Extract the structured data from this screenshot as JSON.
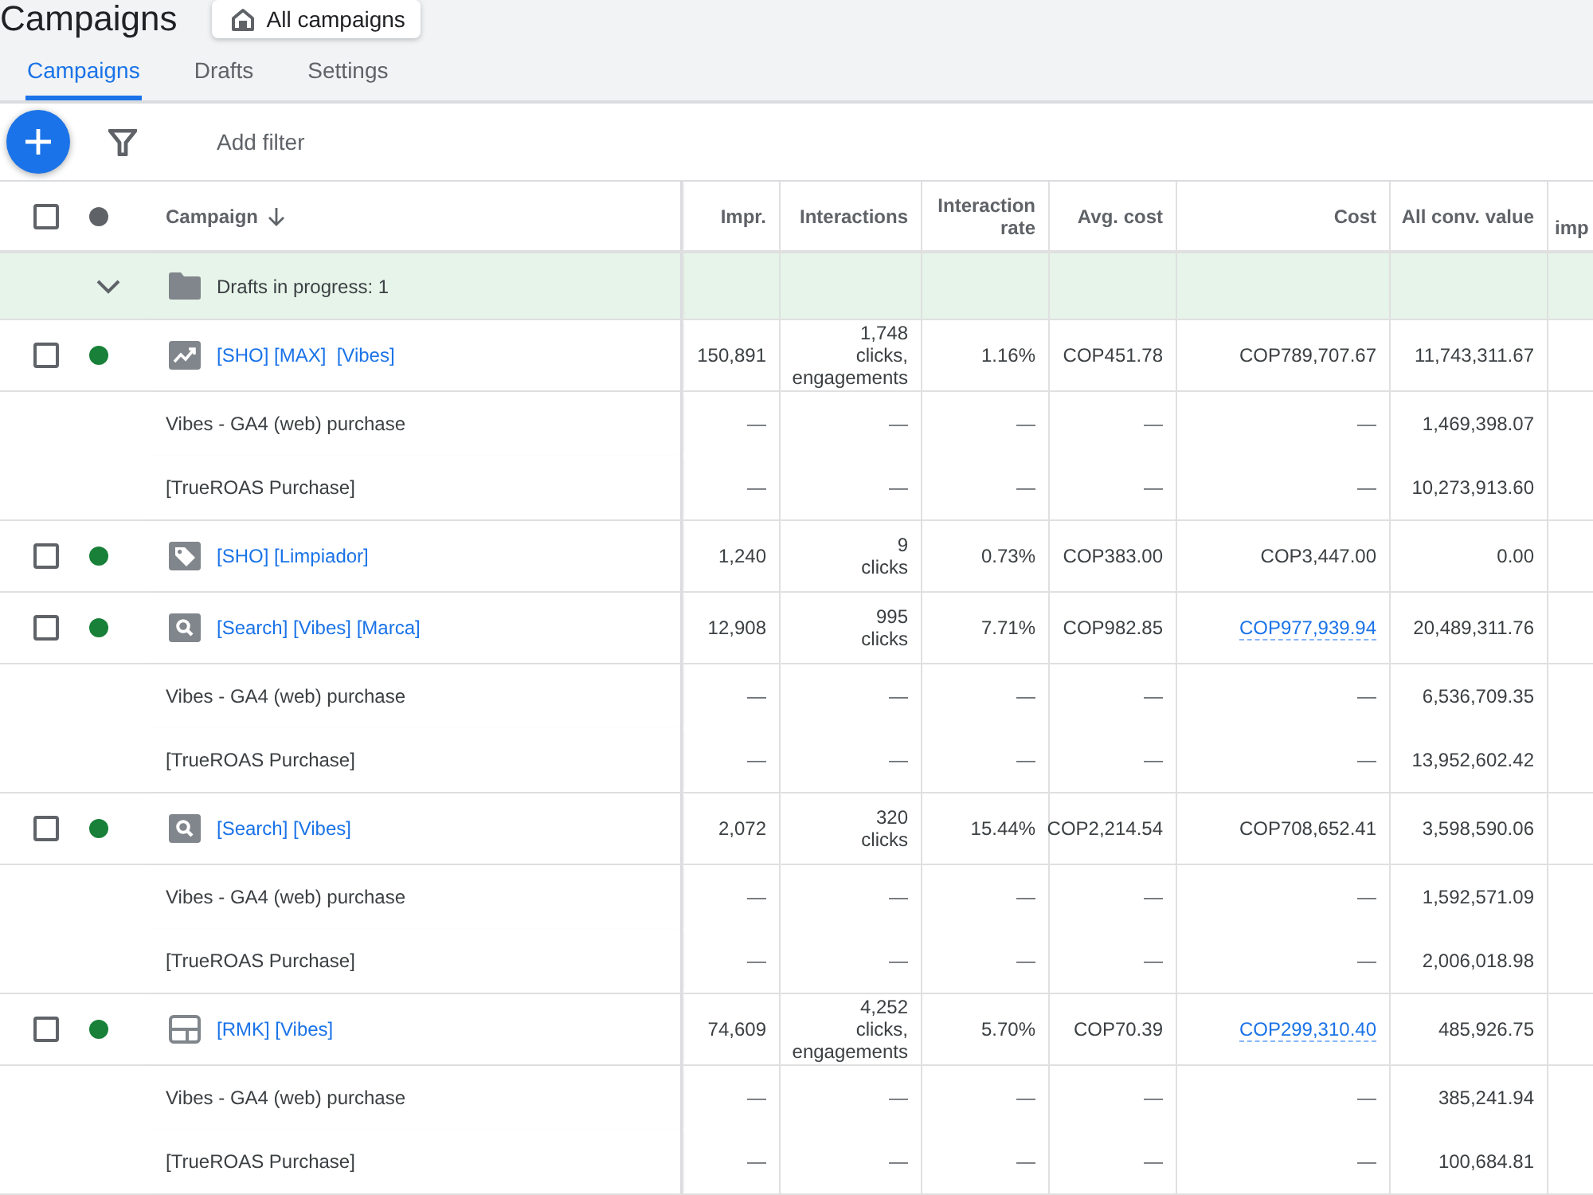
{
  "page": {
    "title": "Campaigns",
    "scope_button": "All campaigns"
  },
  "tabs": [
    {
      "label": "Campaigns",
      "selected": true
    },
    {
      "label": "Drafts",
      "selected": false
    },
    {
      "label": "Settings",
      "selected": false
    }
  ],
  "toolbar": {
    "add_filter": "Add filter"
  },
  "table": {
    "select_all": {
      "checked": false
    },
    "columns": [
      {
        "label": "Campaign",
        "sorted": true
      },
      {
        "label": "Impr.",
        "sorted": false
      },
      {
        "label": "Interactions",
        "sorted": false
      },
      {
        "label": "Interaction rate",
        "sorted": false
      },
      {
        "label": "Avg. cost",
        "sorted": false
      },
      {
        "label": "Cost",
        "sorted": false
      },
      {
        "label": "All conv. value",
        "sorted": false
      },
      {
        "label": "imp",
        "sorted": false
      }
    ],
    "drafts_row": {
      "label": "Drafts in progress: 1"
    },
    "rows": [
      {
        "checked": false,
        "color": "#188038",
        "kind": "performance_max",
        "name": "[SHO] [MAX]  [Vibes]",
        "impr": "150,891",
        "interactions": {
          "count": "1,748",
          "type": "clicks, engagements"
        },
        "rate": "1.16%",
        "avg_cost": "COP451.78",
        "cost": {
          "text": "COP789,707.67",
          "link": false
        },
        "all_conv_value": "11,743,311.67",
        "conversions": [
          {
            "label": "Vibes - GA4 (web) purchase",
            "impr": "—",
            "interactions": "—",
            "rate": "—",
            "avg_cost": "—",
            "cost": "—",
            "all_conv_value": "1,469,398.07"
          },
          {
            "label": "[TrueROAS Purchase]",
            "impr": "—",
            "interactions": "—",
            "rate": "—",
            "avg_cost": "—",
            "cost": "—",
            "all_conv_value": "10,273,913.60"
          }
        ]
      },
      {
        "checked": false,
        "color": "#188038",
        "kind": "shopping",
        "name": "[SHO] [Limpiador]",
        "impr": "1,240",
        "interactions": {
          "count": "9",
          "type": "clicks"
        },
        "rate": "0.73%",
        "avg_cost": "COP383.00",
        "cost": {
          "text": "COP3,447.00",
          "link": false
        },
        "all_conv_value": "0.00"
      },
      {
        "checked": false,
        "color": "#188038",
        "kind": "search",
        "name": "[Search] [Vibes] [Marca]",
        "impr": "12,908",
        "interactions": {
          "count": "995",
          "type": "clicks"
        },
        "rate": "7.71%",
        "avg_cost": "COP982.85",
        "cost": {
          "text": "COP977,939.94",
          "link": true
        },
        "all_conv_value": "20,489,311.76",
        "conversions": [
          {
            "label": "Vibes - GA4 (web) purchase",
            "impr": "—",
            "interactions": "—",
            "rate": "—",
            "avg_cost": "—",
            "cost": "—",
            "all_conv_value": "6,536,709.35"
          },
          {
            "label": "[TrueROAS Purchase]",
            "impr": "—",
            "interactions": "—",
            "rate": "—",
            "avg_cost": "—",
            "cost": "—",
            "all_conv_value": "13,952,602.42"
          }
        ]
      },
      {
        "checked": false,
        "color": "#188038",
        "kind": "search",
        "name": "[Search] [Vibes]",
        "impr": "2,072",
        "interactions": {
          "count": "320",
          "type": "clicks"
        },
        "rate": "15.44%",
        "avg_cost": "COP2,214.54",
        "cost": {
          "text": "COP708,652.41",
          "link": false
        },
        "all_conv_value": "3,598,590.06",
        "conversions": [
          {
            "label": "Vibes - GA4 (web) purchase",
            "impr": "—",
            "interactions": "—",
            "rate": "—",
            "avg_cost": "—",
            "cost": "—",
            "all_conv_value": "1,592,571.09"
          },
          {
            "label": "[TrueROAS Purchase]",
            "impr": "—",
            "interactions": "—",
            "rate": "—",
            "avg_cost": "—",
            "cost": "—",
            "all_conv_value": "2,006,018.98"
          }
        ]
      },
      {
        "checked": false,
        "color": "#188038",
        "kind": "display",
        "name": "[RMK] [Vibes]",
        "impr": "74,609",
        "interactions": {
          "count": "4,252",
          "type": "clicks, engagements"
        },
        "rate": "5.70%",
        "avg_cost": "COP70.39",
        "cost": {
          "text": "COP299,310.40",
          "link": true
        },
        "all_conv_value": "485,926.75",
        "conversions": [
          {
            "label": "Vibes - GA4 (web) purchase",
            "impr": "—",
            "interactions": "—",
            "rate": "—",
            "avg_cost": "—",
            "cost": "—",
            "all_conv_value": "385,241.94"
          },
          {
            "label": "[TrueROAS Purchase]",
            "impr": "—",
            "interactions": "—",
            "rate": "—",
            "avg_cost": "—",
            "cost": "—",
            "all_conv_value": "100,684.81"
          }
        ]
      }
    ]
  }
}
